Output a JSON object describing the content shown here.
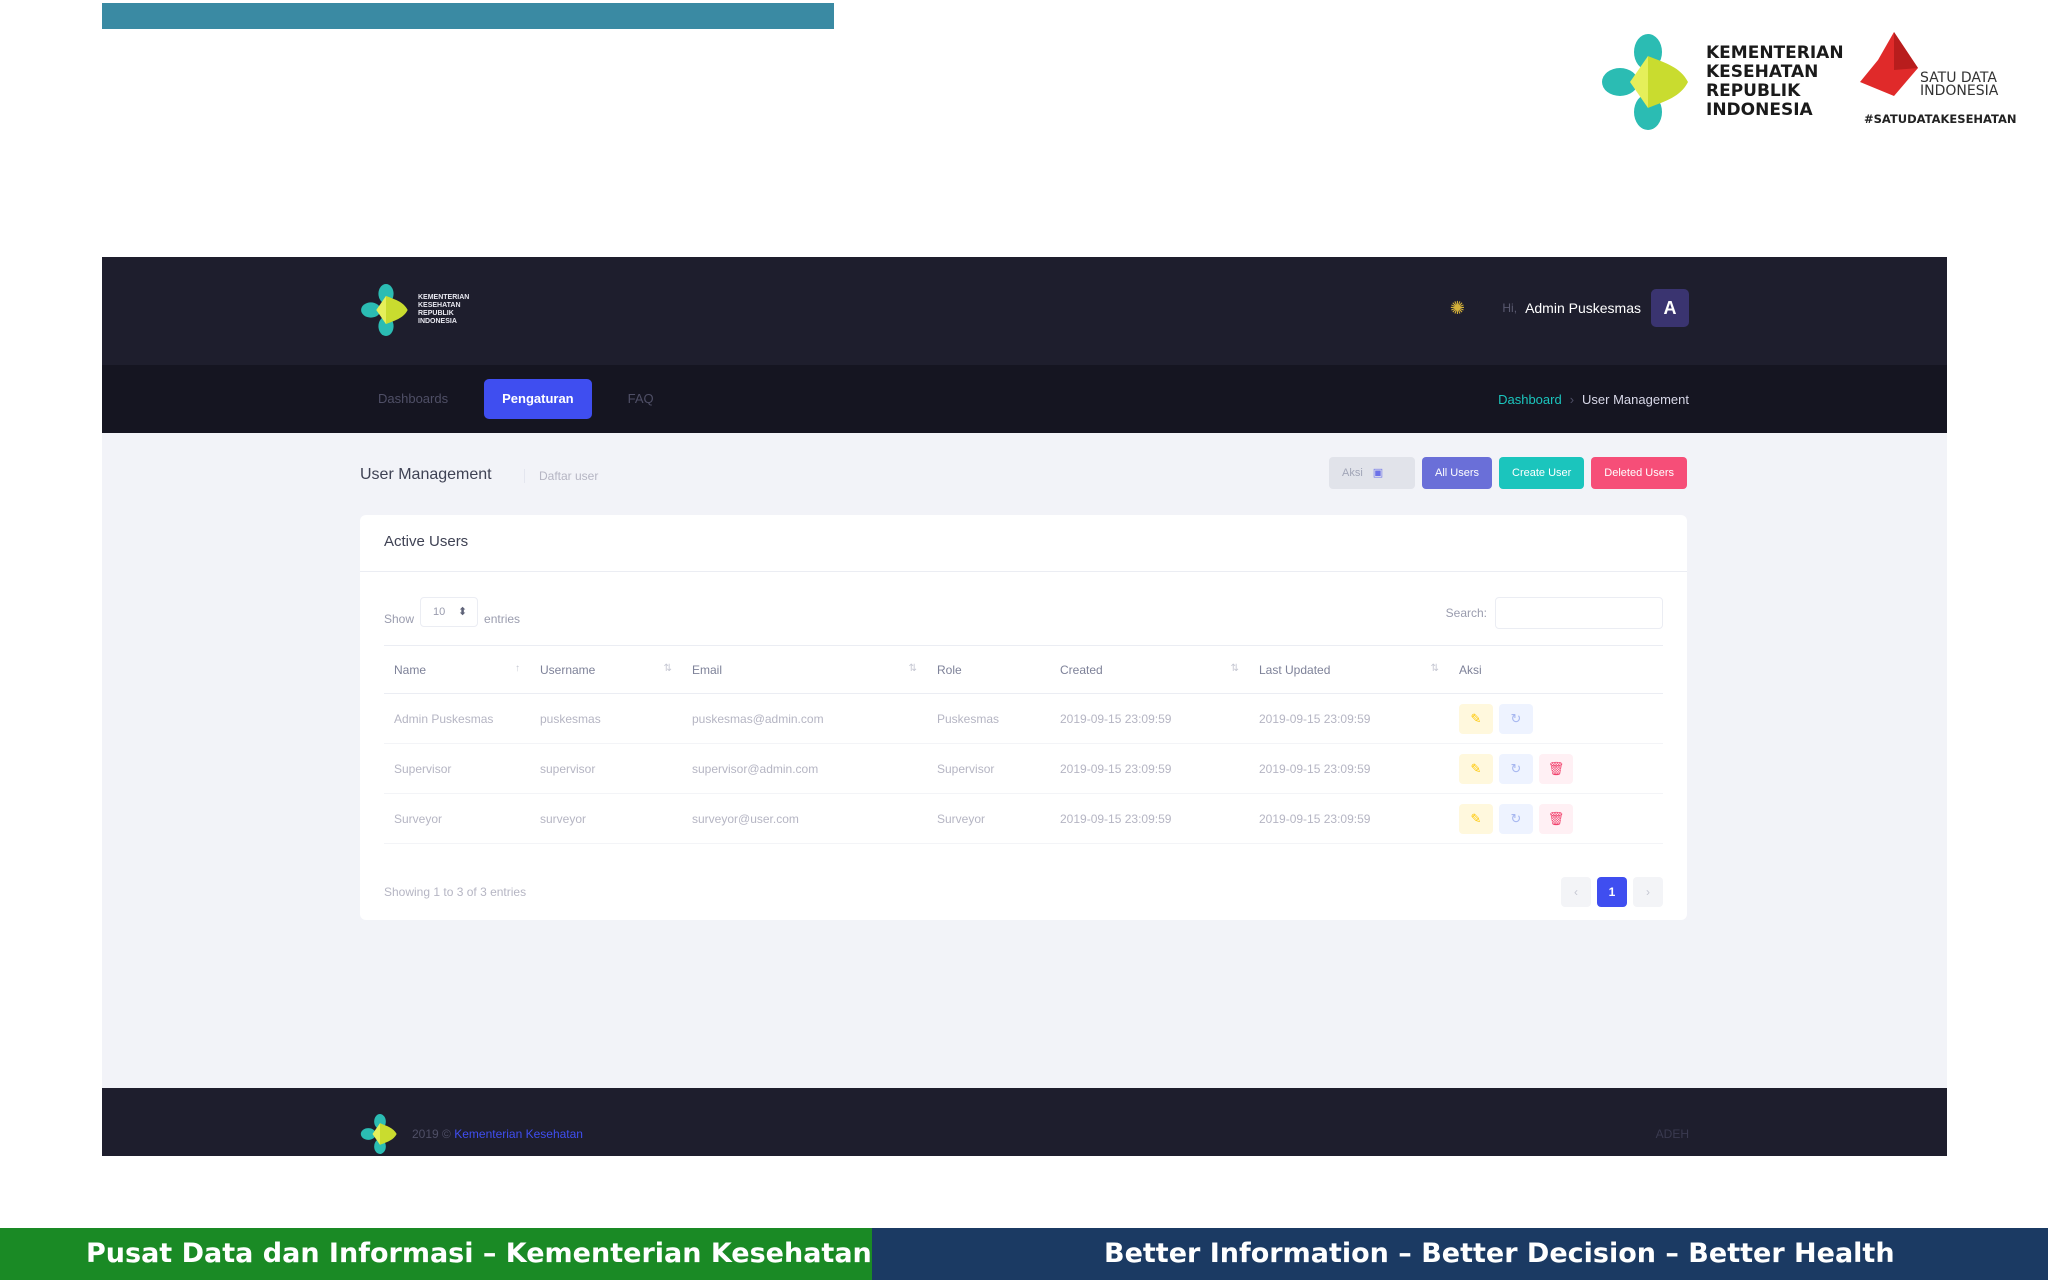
{
  "slide": {
    "ministry_logo_lines": [
      "KEMENTERIAN",
      "KESEHATAN",
      "REPUBLIK",
      "INDONESIA"
    ],
    "satudata_lines": [
      "SATU DATA",
      "INDONESIA"
    ],
    "satudata_tag": "#SATUDATAKESEHATAN",
    "footer_left": "Pusat Data dan Informasi – Kementerian Kesehatan",
    "footer_right": "Better Information – Better Decision – Better Health",
    "colors": {
      "top_bar": "#3a8aa3",
      "footer_left": "#1a8a25",
      "footer_right": "#1b3a63"
    }
  },
  "app": {
    "header": {
      "logo_lines": [
        "KEMENTERIAN",
        "KESEHATAN",
        "REPUBLIK",
        "INDONESIA"
      ],
      "greeting": "Hi,",
      "user_name": "Admin Puskesmas",
      "avatar_letter": "A",
      "theme_icon": "sun-icon"
    },
    "nav": {
      "tabs": [
        {
          "label": "Dashboards",
          "active": false
        },
        {
          "label": "Pengaturan",
          "active": true
        },
        {
          "label": "FAQ",
          "active": false
        }
      ],
      "breadcrumb": {
        "parent": "Dashboard",
        "separator": "›",
        "current": "User Management"
      }
    },
    "subheader": {
      "title": "User Management",
      "subtitle": "Daftar user",
      "buttons": {
        "aksi": "Aksi",
        "all_users": "All Users",
        "create_user": "Create User",
        "deleted_users": "Deleted Users"
      }
    },
    "card": {
      "title": "Active Users",
      "show_label": "Show",
      "entries_value": "10",
      "entries_label": "entries",
      "search_label": "Search:",
      "search_value": "",
      "columns": [
        "Name",
        "Username",
        "Email",
        "Role",
        "Created",
        "Last Updated",
        "Aksi"
      ],
      "rows": [
        {
          "name": "Admin Puskesmas",
          "username": "puskesmas",
          "email": "puskesmas@admin.com",
          "role": "Puskesmas",
          "created": "2019-09-15 23:09:59",
          "updated": "2019-09-15 23:09:59",
          "deletable": false
        },
        {
          "name": "Supervisor",
          "username": "supervisor",
          "email": "supervisor@admin.com",
          "role": "Supervisor",
          "created": "2019-09-15 23:09:59",
          "updated": "2019-09-15 23:09:59",
          "deletable": true
        },
        {
          "name": "Surveyor",
          "username": "surveyor",
          "email": "surveyor@user.com",
          "role": "Surveyor",
          "created": "2019-09-15 23:09:59",
          "updated": "2019-09-15 23:09:59",
          "deletable": true
        }
      ],
      "info": "Showing 1 to 3 of 3 entries",
      "pager": {
        "prev": "‹",
        "current": "1",
        "next": "›"
      }
    },
    "footer": {
      "copyright_prefix": "2019 ©",
      "copyright_link": "Kementerian Kesehatan",
      "version": "ADEH"
    }
  }
}
